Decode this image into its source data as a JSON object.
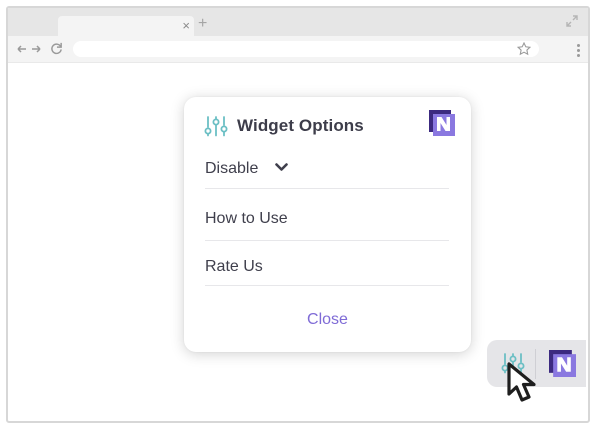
{
  "browser": {
    "tab_close_glyph": "×",
    "new_tab_glyph": "+",
    "icons": {
      "expand": "expand-icon",
      "back_forward": "back-forward-arrows-icon",
      "reload": "reload-icon",
      "star": "bookmark-star-icon",
      "menu": "kebab-menu-icon"
    }
  },
  "popup": {
    "title": "Widget Options",
    "items": [
      {
        "label": "Disable"
      },
      {
        "label": "How to Use"
      },
      {
        "label": "Rate Us"
      }
    ],
    "close_label": "Close"
  },
  "colors": {
    "accent": "#7f6bd6",
    "icon_teal": "#6bbfc4",
    "brand_dark": "#3c2a80",
    "brand_light": "#8a78e0"
  }
}
